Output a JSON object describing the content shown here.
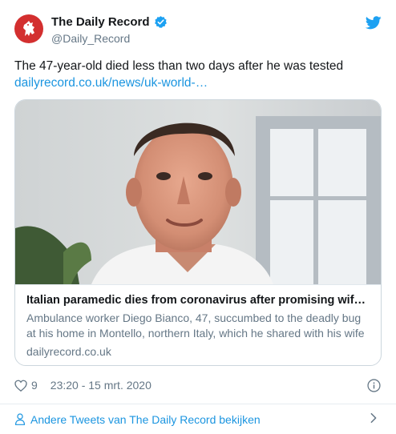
{
  "account": {
    "name": "The Daily Record",
    "handle": "@Daily_Record"
  },
  "tweet": {
    "text": "The 47-year-old died less than two days after he was tested",
    "link": "dailyrecord.co.uk/news/uk-world-…"
  },
  "card": {
    "title": "Italian paramedic dies from coronavirus after promising wife ...",
    "description": "Ambulance worker Diego Bianco, 47, succumbed to the deadly bug at his home in Montello, northern Italy, which he shared with his wife",
    "domain": "dailyrecord.co.uk"
  },
  "meta": {
    "likes": "9",
    "timestamp": "23:20 - 15 mrt. 2020"
  },
  "footer": {
    "more_tweets": "Andere Tweets van The Daily Record bekijken"
  },
  "icons": {
    "avatar": "lion-rampant-logo",
    "verified": "verified-badge-icon",
    "brand": "twitter-bird-icon",
    "like": "heart-icon",
    "info": "info-icon",
    "profile": "person-icon",
    "more": "chevron-right-icon"
  },
  "colors": {
    "link": "#1b95e0",
    "brand_blue": "#1da1f2",
    "avatar_red": "#d32f2f",
    "muted_text": "#657786"
  }
}
